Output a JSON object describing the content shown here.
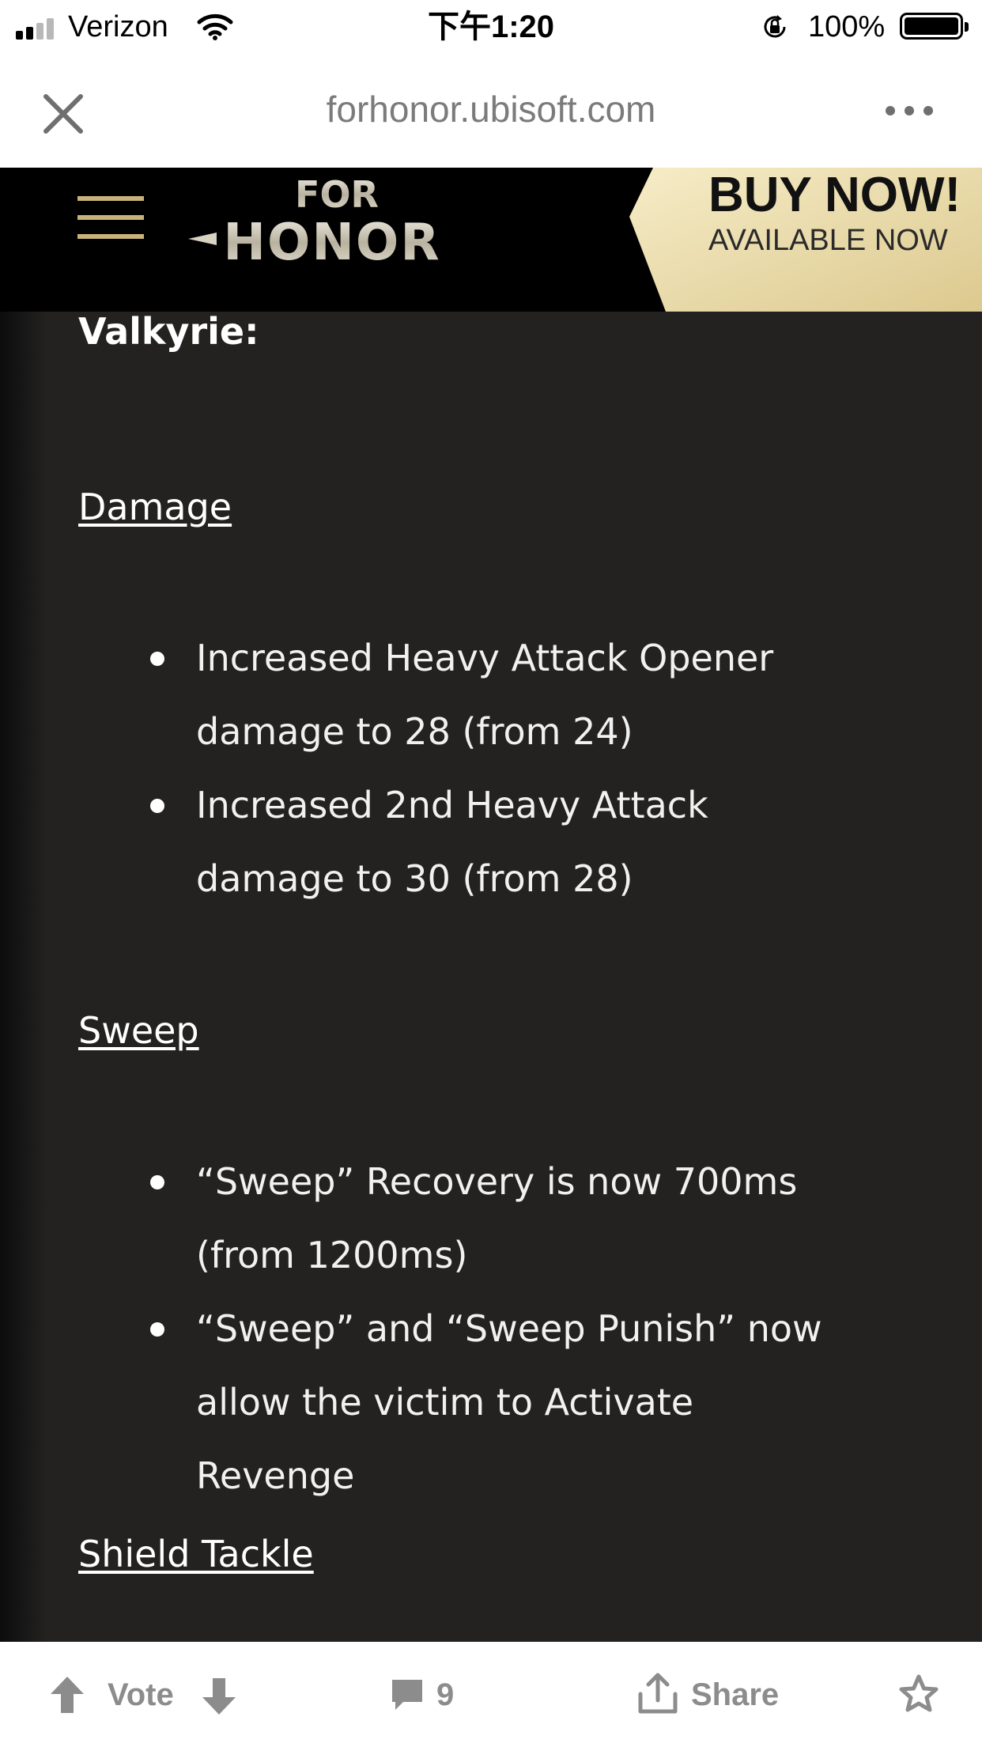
{
  "status_bar": {
    "carrier": "Verizon",
    "time": "下午1:20",
    "battery_percent": "100%"
  },
  "browser": {
    "url": "forhonor.ubisoft.com"
  },
  "site_header": {
    "logo_top": "FOR",
    "logo_bottom": "HONOR",
    "buy_title": "BUY NOW!",
    "buy_subtitle": "AVAILABLE NOW"
  },
  "content": {
    "hero_name": "Valkyrie:",
    "sections": [
      {
        "heading": "Damage",
        "items": [
          "Increased Heavy Attack Opener damage to 28 (from 24)",
          "Increased 2nd Heavy Attack damage to 30 (from 28)"
        ]
      },
      {
        "heading": "Sweep",
        "items": [
          "“Sweep” Recovery is now 700ms (from 1200ms)",
          "“Sweep” and “Sweep Punish” now allow the victim to Activate Revenge"
        ]
      },
      {
        "heading": "Shield Tackle",
        "items": []
      }
    ]
  },
  "toolbar": {
    "vote_label": "Vote",
    "comment_count": "9",
    "share_label": "Share"
  },
  "colors": {
    "content_bg": "#232221",
    "header_bg": "#000000",
    "accent_gold": "#e8d9a6",
    "toolbar_text": "#8c8c8c"
  }
}
